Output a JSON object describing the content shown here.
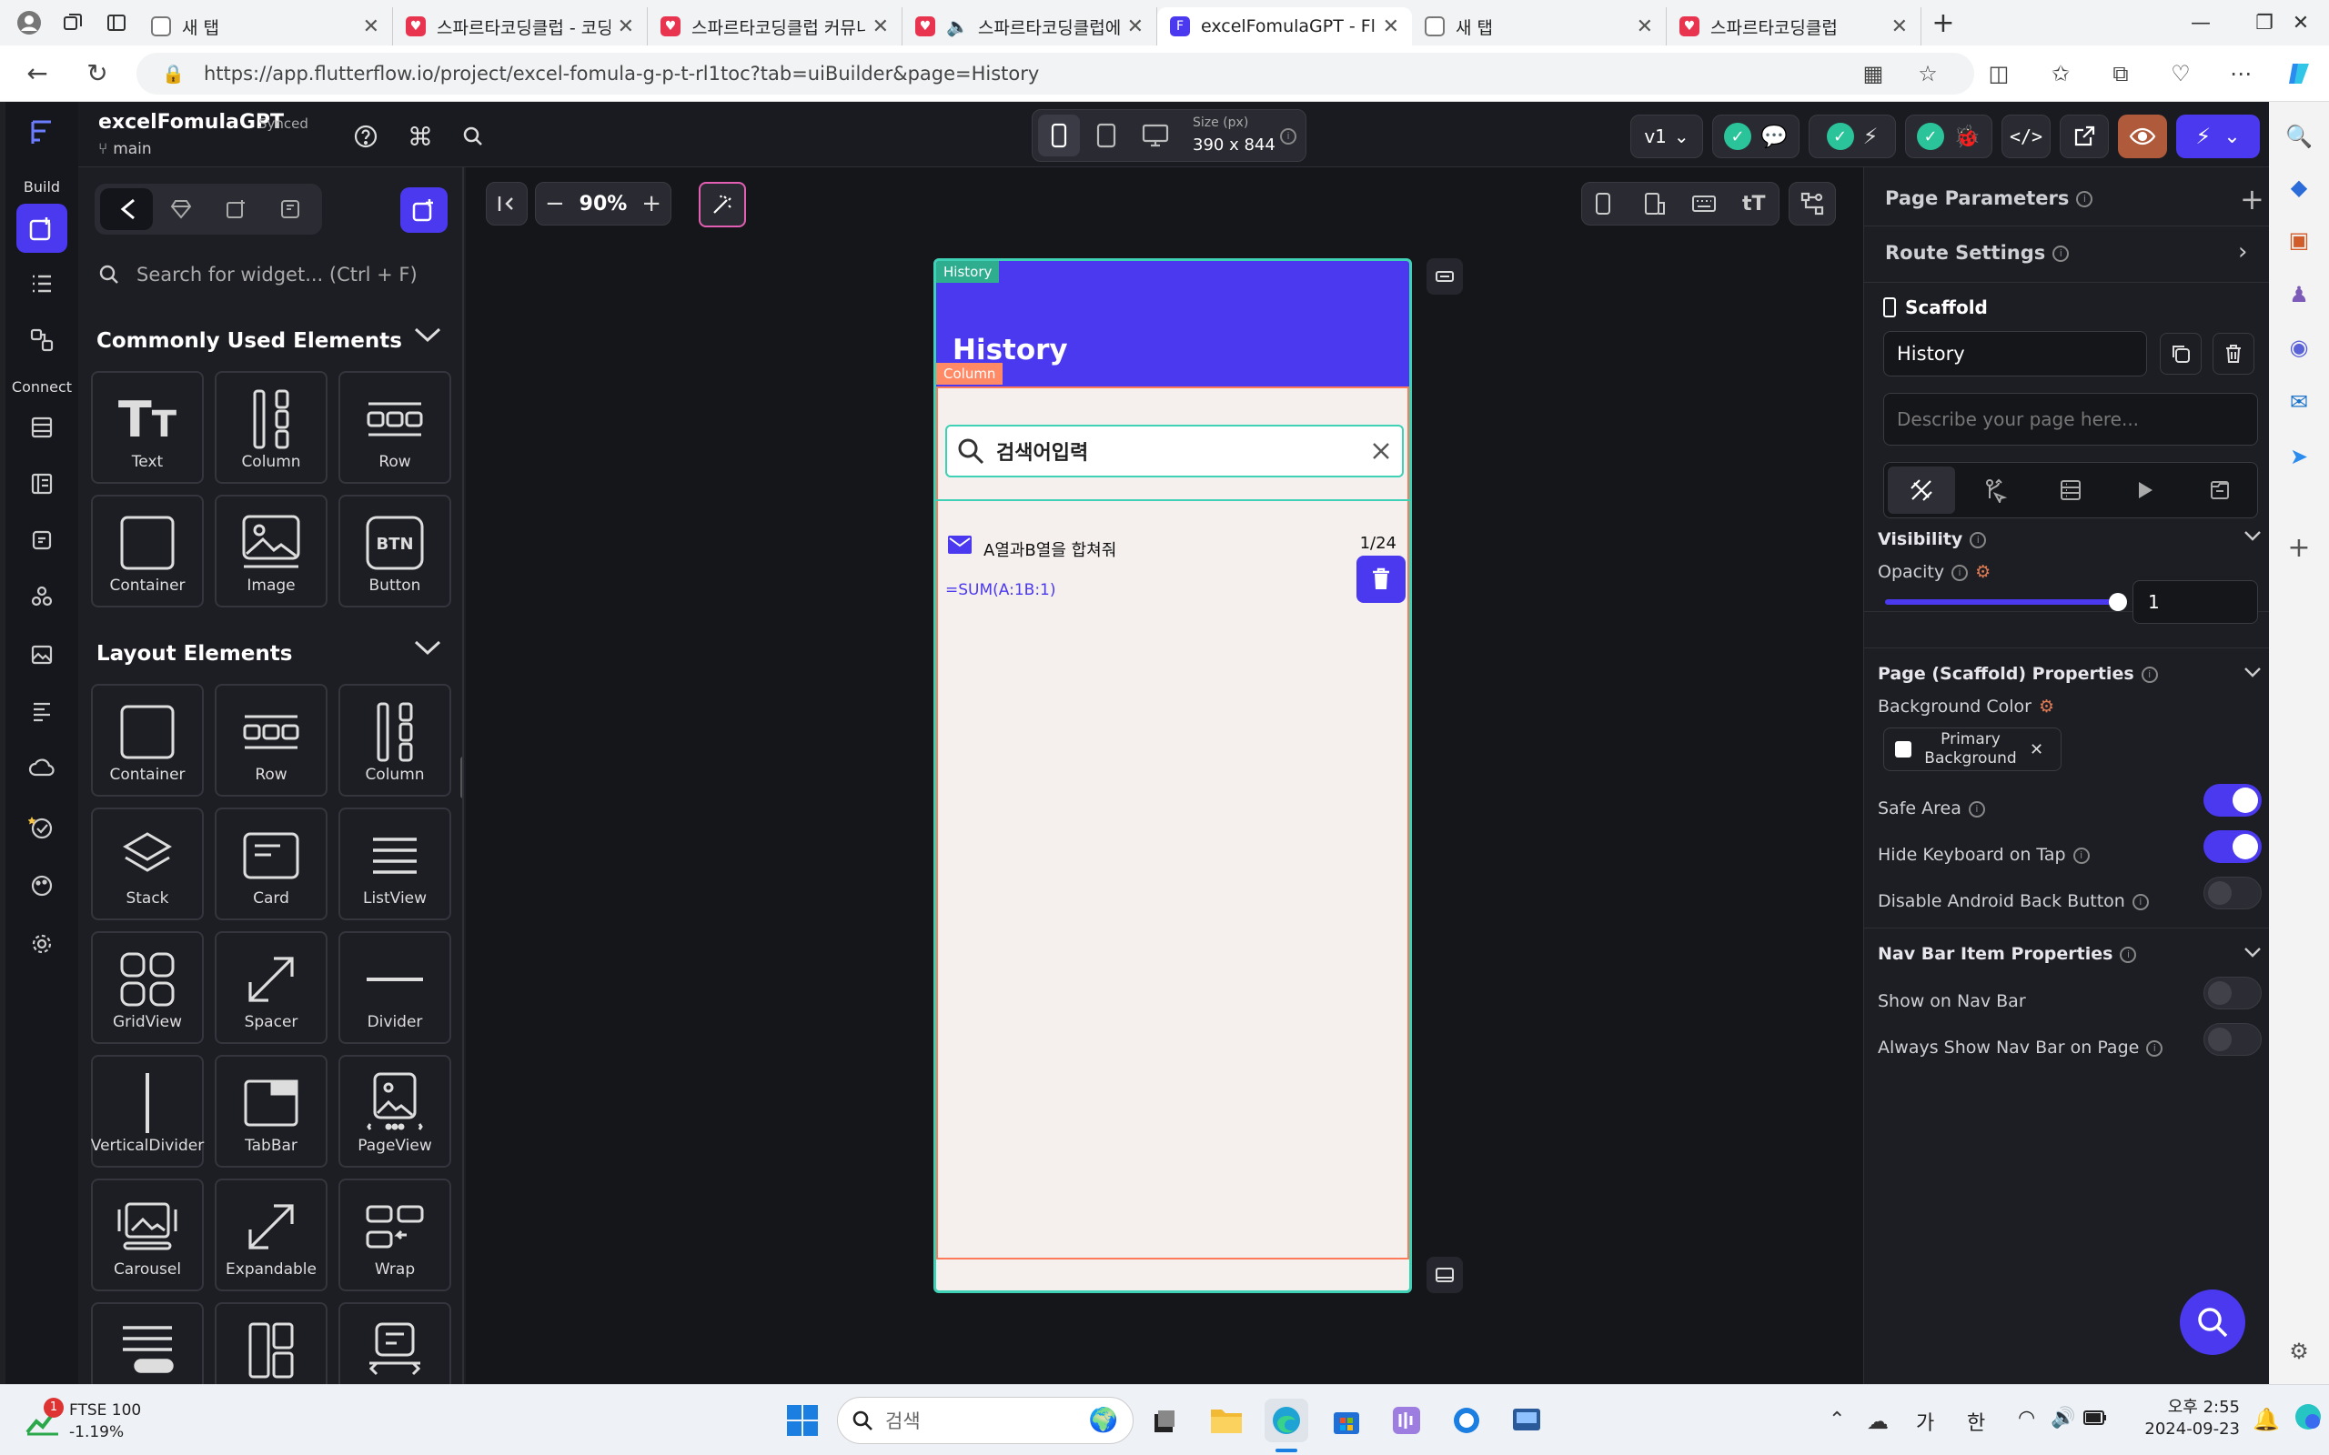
{
  "browser": {
    "tabs": [
      {
        "title": "새 탭",
        "icon": "page-icon"
      },
      {
        "title": "스파르타코딩클럽 - 코딩",
        "icon": "sparta-heart-icon"
      },
      {
        "title": "스파르타코딩클럽 커뮤니",
        "icon": "sparta-heart-icon"
      },
      {
        "title": "스파르타코딩클럽에",
        "icon": "sparta-heart-icon"
      },
      {
        "title": "excelFomulaGPT - Flutter",
        "icon": "flutterflow-icon"
      },
      {
        "title": "새 탭",
        "icon": "page-icon"
      },
      {
        "title": "스파르타코딩클럽",
        "icon": "sparta-heart-icon"
      }
    ],
    "url": "https://app.flutterflow.io/project/excel-fomula-g-p-t-rl1toc?tab=uiBuilder&page=History"
  },
  "rail": {
    "build_label": "Build",
    "connect_label": "Connect"
  },
  "topbar": {
    "project_name": "excelFomulaGPT",
    "sync_status": "Synced",
    "branch": "main",
    "size_label": "Size (px)",
    "size_value": "390 x 844",
    "version": "v1"
  },
  "widget_panel": {
    "search_placeholder": "Search for widget... (Ctrl + F)",
    "common_title": "Commonly Used Elements",
    "common_items": [
      "Text",
      "Column",
      "Row",
      "Container",
      "Image",
      "Button"
    ],
    "layout_title": "Layout Elements",
    "layout_items": [
      "Container",
      "Row",
      "Column",
      "Stack",
      "Card",
      "ListView",
      "GridView",
      "Spacer",
      "Divider",
      "VerticalDivider",
      "TabBar",
      "PageView",
      "Carousel",
      "Expandable",
      "Wrap"
    ]
  },
  "canvas": {
    "zoom": "90%",
    "page_tag": "History",
    "page_title": "History",
    "column_tag": "Column",
    "search_text": "검색어입력",
    "item_title": "A열과B열을 합쳐줘",
    "item_date": "1/24",
    "item_formula": "=SUM(A:1B:1)"
  },
  "properties": {
    "page_parameters": "Page Parameters",
    "route_settings": "Route Settings",
    "scaffold_label": "Scaffold",
    "page_name": "History",
    "describe_placeholder": "Describe your page here...",
    "visibility_title": "Visibility",
    "opacity_label": "Opacity",
    "opacity_value": "1",
    "opacity_level": 1.0,
    "scaffold_props_title": "Page (Scaffold) Properties",
    "bg_color_label": "Background Color",
    "bg_color_value": "Primary Background",
    "safe_area": "Safe Area",
    "hide_keyboard": "Hide Keyboard on Tap",
    "disable_back": "Disable Android Back Button",
    "navbar_title": "Nav Bar Item Properties",
    "show_on_navbar": "Show on Nav Bar",
    "always_show_navbar": "Always Show Nav Bar on Page"
  },
  "toggles": {
    "safe_area": true,
    "hide_keyboard": true,
    "disable_back": false,
    "show_on_navbar": false,
    "always_show_navbar": false
  },
  "taskbar": {
    "stock_name": "FTSE 100",
    "stock_change": "-1.19%",
    "notif_count": "1",
    "search_placeholder": "검색",
    "ime_1": "가",
    "ime_2": "한",
    "time": "오후 2:55",
    "date": "2024-09-23"
  },
  "colors": {
    "accent": "#4b39ef",
    "canvas_bg": "#f5f0ee",
    "frame_teal": "#3ed1b5",
    "frame_orange": "#ff7a59",
    "panel_bg": "#1d1e24"
  }
}
